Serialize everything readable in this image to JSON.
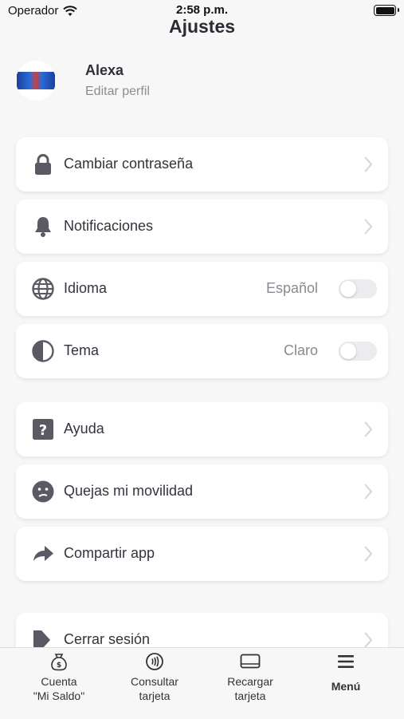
{
  "status_bar": {
    "carrier": "Operador",
    "time": "2:58 p.m."
  },
  "header": {
    "title": "Ajustes"
  },
  "profile": {
    "name": "Alexa",
    "edit_label": "Editar perfil"
  },
  "settings": {
    "change_password": "Cambiar contraseña",
    "notifications": "Notificaciones",
    "language": {
      "label": "Idioma",
      "value": "Español",
      "toggle_on": false
    },
    "theme": {
      "label": "Tema",
      "value": "Claro",
      "toggle_on": false
    },
    "help": "Ayuda",
    "complaints": "Quejas mi movilidad",
    "share": "Compartir app",
    "logout": "Cerrar sesión"
  },
  "tabbar": {
    "account": "Cuenta\n\"Mi Saldo\"",
    "check_card": "Consultar\ntarjeta",
    "recharge_card": "Recargar\ntarjeta",
    "menu": "Menú"
  },
  "colors": {
    "icon": "#5a5a64",
    "chevron": "#d8d8dc",
    "card": "#ffffff",
    "background": "#f7f7f7"
  }
}
